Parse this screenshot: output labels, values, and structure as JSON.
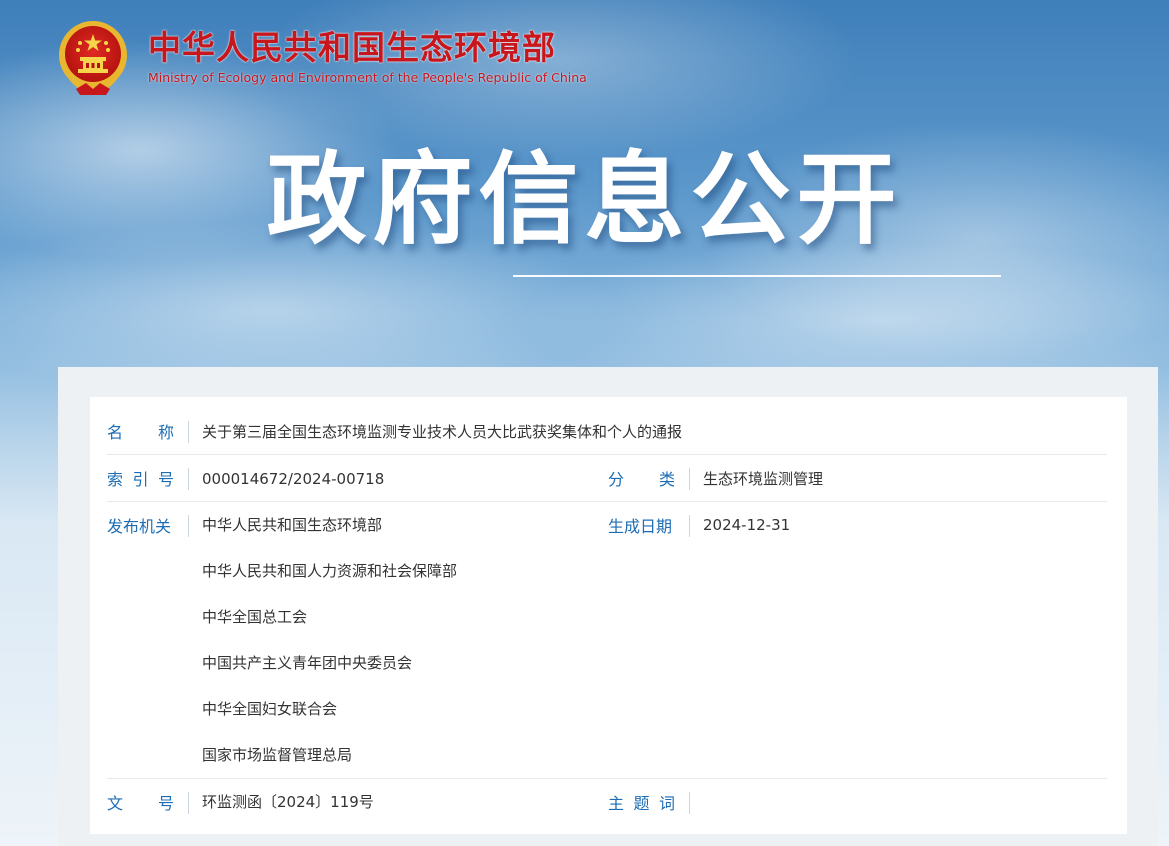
{
  "header": {
    "site_name_zh": "中华人民共和国生态环境部",
    "site_name_en": "Ministry of Ecology and Environment of the People's Republic of China",
    "emblem_icon": "national-emblem-icon"
  },
  "hero": {
    "title": "政府信息公开"
  },
  "info": {
    "name_label": "名　称",
    "name_value": "关于第三届全国生态环境监测专业技术人员大比武获奖集体和个人的通报",
    "index_label": "索引号",
    "index_value": "000014672/2024-00718",
    "category_label": "分　类",
    "category_value": "生态环境监测管理",
    "issuer_label": "发布机关",
    "issuers": [
      "中华人民共和国生态环境部",
      "中华人民共和国人力资源和社会保障部",
      "中华全国总工会",
      "中国共产主义青年团中央委员会",
      "中华全国妇女联合会",
      "国家市场监督管理总局"
    ],
    "date_label": "生成日期",
    "date_value": "2024-12-31",
    "docno_label": "文　号",
    "docno_value": "环监测函〔2024〕119号",
    "keywords_label": "主题词",
    "keywords_value": ""
  },
  "colors": {
    "brand_red": "#c8161d",
    "label_blue": "#1d6db4",
    "text_dark": "#333333"
  }
}
